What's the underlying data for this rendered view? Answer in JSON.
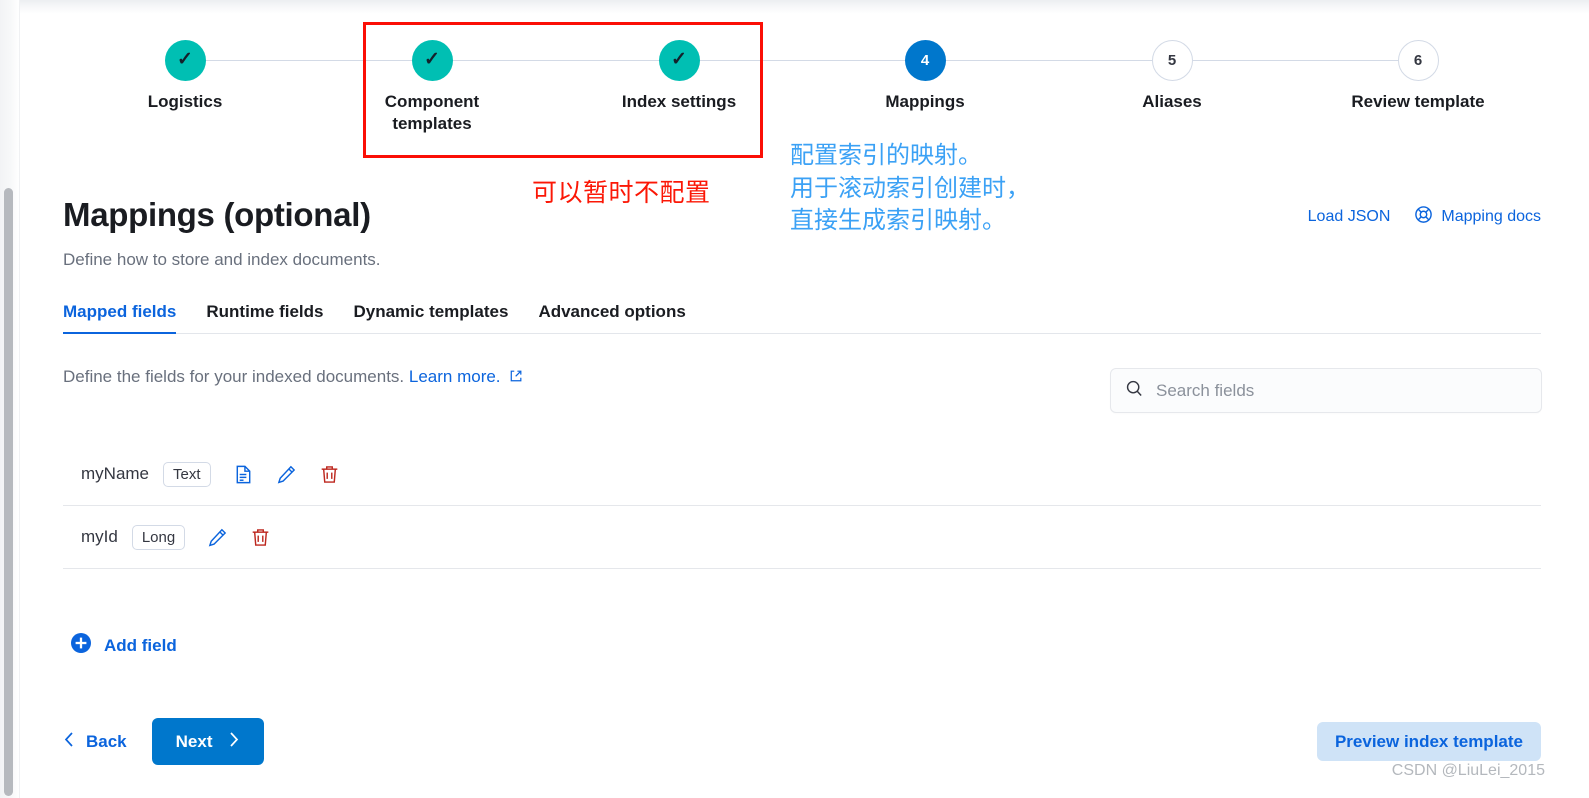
{
  "stepper": {
    "steps": [
      {
        "label": "Logistics",
        "state": "done",
        "marker": "✓"
      },
      {
        "label": "Component templates",
        "state": "done",
        "marker": "✓"
      },
      {
        "label": "Index settings",
        "state": "done",
        "marker": "✓"
      },
      {
        "label": "Mappings",
        "state": "current",
        "marker": "4"
      },
      {
        "label": "Aliases",
        "state": "todo",
        "marker": "5"
      },
      {
        "label": "Review template",
        "state": "todo",
        "marker": "6"
      }
    ]
  },
  "annotations": {
    "red_note": "可以暂时不配置",
    "blue_note_line1": "配置索引的映射。",
    "blue_note_line2": "用于滚动索引创建时，",
    "blue_note_line3": "直接生成索引映射。",
    "red_color": "#fb0f06",
    "blue_color": "#3ba1f5"
  },
  "page": {
    "title": "Mappings (optional)",
    "subtitle": "Define how to store and index documents.",
    "load_json_label": "Load JSON",
    "mapping_docs_label": "Mapping docs",
    "mapping_docs_icon": "lifebuoy-icon"
  },
  "tabs": [
    {
      "label": "Mapped fields",
      "active": true
    },
    {
      "label": "Runtime fields",
      "active": false
    },
    {
      "label": "Dynamic templates",
      "active": false
    },
    {
      "label": "Advanced options",
      "active": false
    }
  ],
  "description": {
    "text": "Define the fields for your indexed documents.",
    "link_label": "Learn more.",
    "link_icon": "external-link-icon"
  },
  "search": {
    "placeholder": "Search fields",
    "value": "",
    "icon": "search-icon"
  },
  "fields": [
    {
      "name": "myName",
      "type": "Text",
      "icons": [
        "document-icon",
        "pencil-edit-icon",
        "trash-delete-icon"
      ]
    },
    {
      "name": "myId",
      "type": "Long",
      "icons": [
        "pencil-edit-icon",
        "trash-delete-icon"
      ]
    }
  ],
  "add_field": {
    "label": "Add field",
    "icon": "plus-circle-icon"
  },
  "footer": {
    "back_label": "Back",
    "back_icon": "chevron-left-icon",
    "next_label": "Next",
    "next_icon": "chevron-right-icon",
    "preview_label": "Preview index template"
  },
  "watermark": "CSDN @LiuLei_2015",
  "colors": {
    "accent_blue": "#0077CC",
    "link_blue": "#0b64dd",
    "done_teal": "#00BFB3",
    "danger_red": "#bd271e"
  }
}
